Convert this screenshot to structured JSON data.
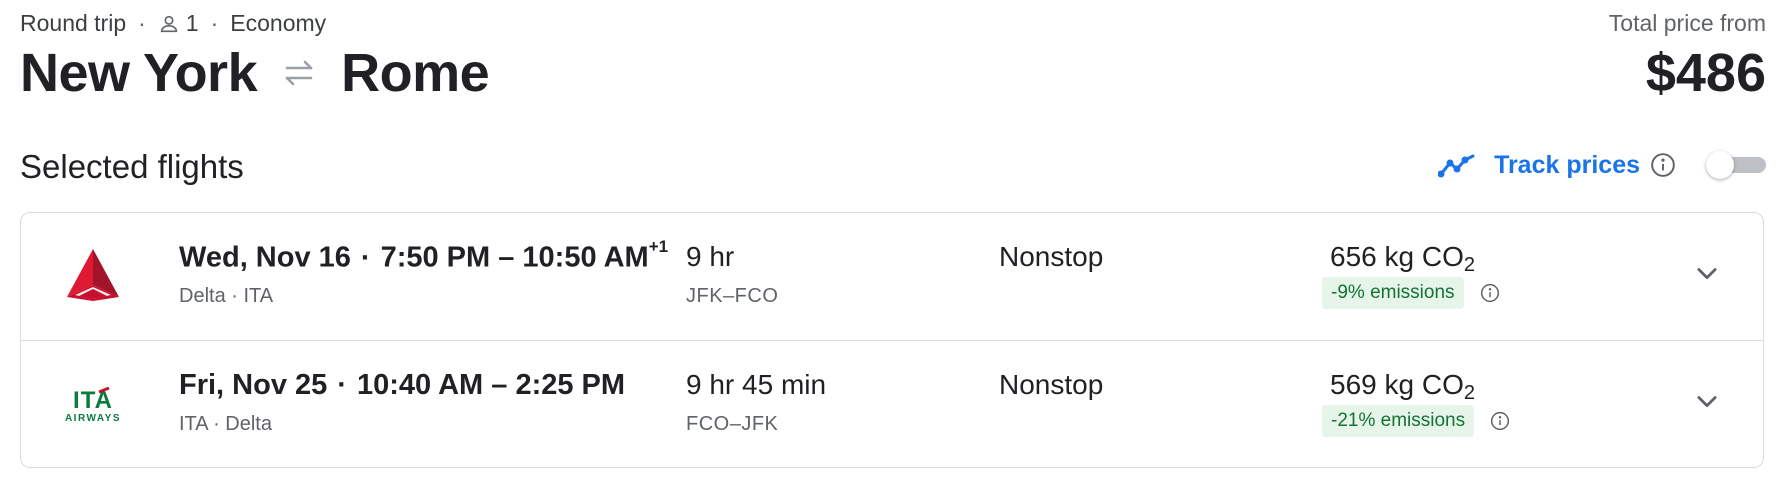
{
  "header": {
    "trip_type": "Round trip",
    "passengers": "1",
    "cabin": "Economy",
    "origin": "New York",
    "destination": "Rome",
    "price_label": "Total price from",
    "price": "$486"
  },
  "section": {
    "title": "Selected flights",
    "track_label": "Track prices",
    "track_enabled": false
  },
  "flights": [
    {
      "airline_logo": "delta-logo",
      "date": "Wed, Nov 16",
      "times": "7:50 PM – 10:50 AM",
      "day_offset": "+1",
      "airlines": "Delta · ITA",
      "duration": "9 hr",
      "airports": "JFK–FCO",
      "stops": "Nonstop",
      "co2": "656 kg CO",
      "co2_sub": "2",
      "emissions": "-9% emissions"
    },
    {
      "airline_logo": "ita-airways-logo",
      "date": "Fri, Nov 25",
      "times": "10:40 AM – 2:25 PM",
      "day_offset": "",
      "airlines": "ITA · Delta",
      "duration": "9 hr 45 min",
      "airports": "FCO–JFK",
      "stops": "Nonstop",
      "co2": "569 kg CO",
      "co2_sub": "2",
      "emissions": "-21% emissions"
    }
  ],
  "logo_text": {
    "ita_main": "ITA",
    "ita_sub": "AIRWAYS"
  },
  "colors": {
    "accent": "#1a73e8",
    "emissions_bg": "#e6f4ea",
    "emissions_text": "#137333",
    "delta_red": "#c8102e",
    "ita_green": "#0b7a3e"
  }
}
